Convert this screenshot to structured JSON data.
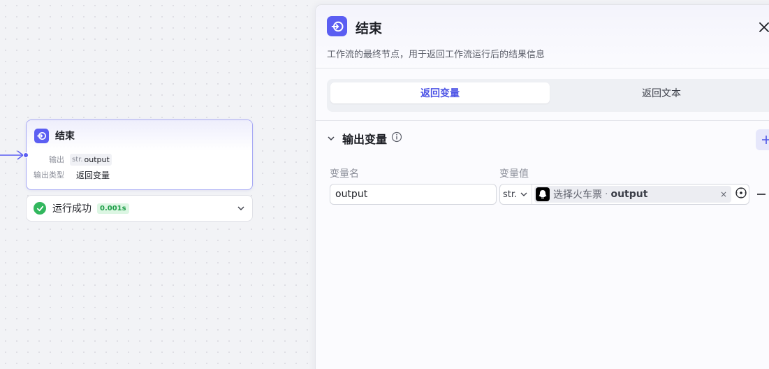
{
  "canvas": {
    "node": {
      "title": "结束",
      "output_label": "输出",
      "output_type_prefix": "str.",
      "output_value": "output",
      "output_type_label": "输出类型",
      "output_type_value": "返回变量"
    },
    "run_status": {
      "text": "运行成功",
      "duration": "0.001s"
    }
  },
  "panel": {
    "title": "结束",
    "description": "工作流的最终节点，用于返回工作流运行后的结果信息",
    "tabs": [
      {
        "label": "返回变量",
        "active": true
      },
      {
        "label": "返回文本",
        "active": false
      }
    ],
    "section": {
      "title": "输出变量",
      "col_name": "变量名",
      "col_value": "变量值",
      "rows": [
        {
          "name": "output",
          "type": "str.",
          "ref_source": "选择火车票",
          "ref_separator": "·",
          "ref_var": "output",
          "clear_glyph": "×"
        }
      ]
    }
  },
  "colors": {
    "accent": "#5b5ef2",
    "success": "#32b75e"
  }
}
